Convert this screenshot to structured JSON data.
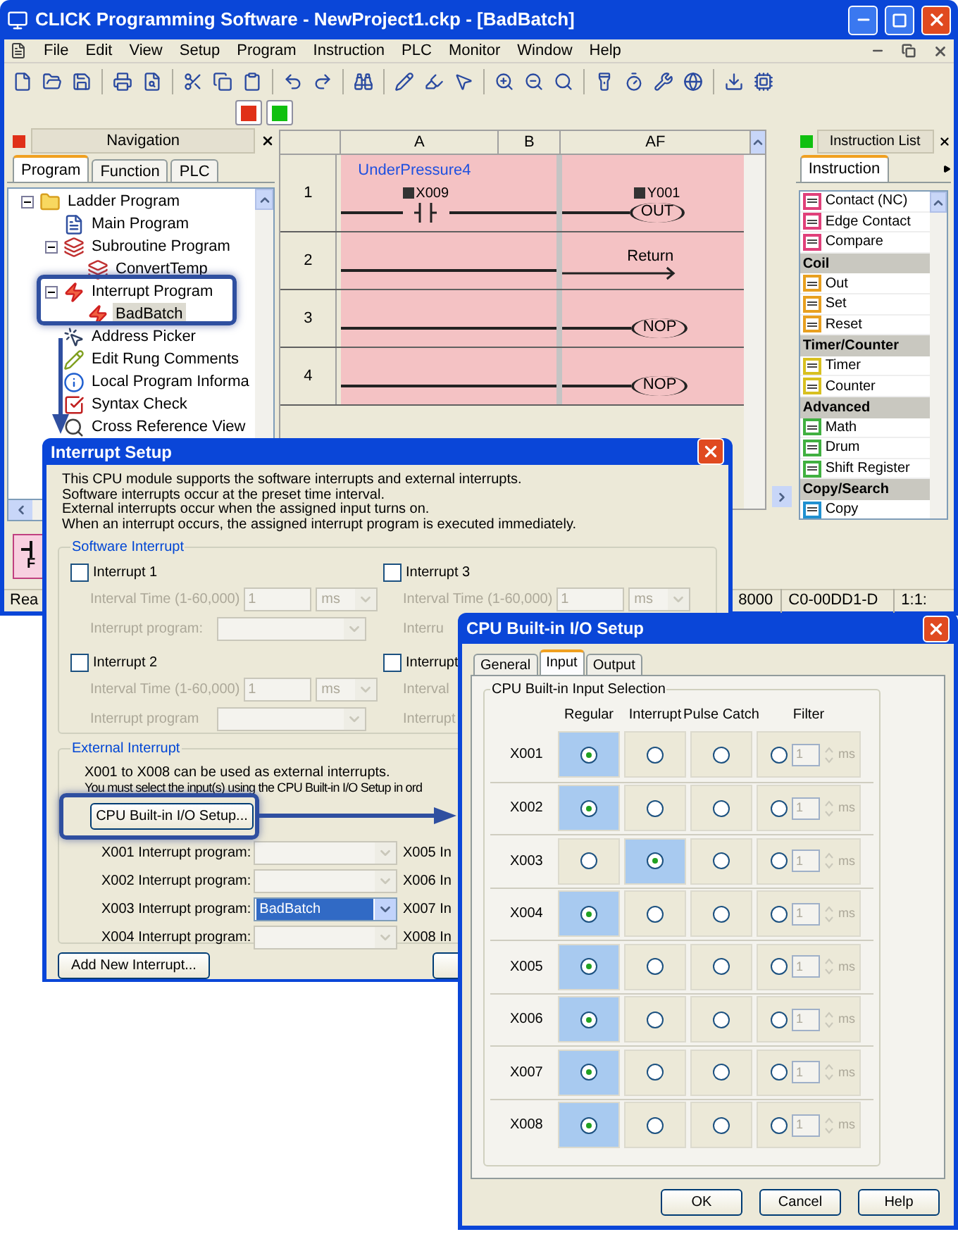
{
  "window": {
    "title": "CLICK Programming Software - NewProject1.ckp - [BadBatch]"
  },
  "menu": [
    "File",
    "Edit",
    "View",
    "Setup",
    "Program",
    "Instruction",
    "PLC",
    "Monitor",
    "Window",
    "Help"
  ],
  "navigation": {
    "title": "Navigation",
    "tabs": [
      {
        "label": "Program",
        "selected": true
      },
      {
        "label": "Function",
        "selected": false
      },
      {
        "label": "PLC",
        "selected": false
      }
    ],
    "tree": [
      {
        "label": "Ladder Program",
        "kind": "folder",
        "expanded": true,
        "selected": false,
        "children": [
          {
            "label": "Main Program",
            "kind": "program",
            "selected": false
          },
          {
            "label": "Subroutine Program",
            "kind": "subroutine",
            "expanded": true,
            "selected": false,
            "children": [
              {
                "label": "ConvertTemp",
                "kind": "subroutine",
                "selected": false
              }
            ]
          },
          {
            "label": "Interrupt Program",
            "kind": "interrupt",
            "expanded": true,
            "selected": false,
            "children": [
              {
                "label": "BadBatch",
                "kind": "interrupt",
                "selected": true
              }
            ]
          },
          {
            "label": "Address Picker",
            "kind": "picker",
            "selected": false
          },
          {
            "label": "Edit Rung Comments",
            "kind": "comment",
            "selected": false
          },
          {
            "label": "Local Program Informa",
            "kind": "info",
            "selected": false
          },
          {
            "label": "Syntax Check",
            "kind": "check",
            "selected": false
          },
          {
            "label": "Cross Reference View",
            "kind": "crossref",
            "selected": false
          }
        ]
      }
    ],
    "function_key": "F"
  },
  "ladder": {
    "columns": [
      "A",
      "B",
      "AF"
    ],
    "rows": [
      {
        "number": "1",
        "kind": "coil",
        "comment": "UnderPressure4",
        "contact": "X009",
        "coil": "Y001",
        "instruction": "OUT"
      },
      {
        "number": "2",
        "kind": "return",
        "instruction": "Return"
      },
      {
        "number": "3",
        "kind": "nop",
        "instruction": "NOP"
      },
      {
        "number": "4",
        "kind": "nop",
        "instruction": "NOP"
      }
    ]
  },
  "instruction_list": {
    "title": "Instruction List",
    "tab": "Instruction",
    "items": [
      {
        "kind": "item",
        "label": "Contact (NC)",
        "color": "#e0407a"
      },
      {
        "kind": "item",
        "label": "Edge Contact",
        "color": "#e0407a"
      },
      {
        "kind": "item",
        "label": "Compare",
        "color": "#e0407a"
      },
      {
        "kind": "category",
        "label": "Coil"
      },
      {
        "kind": "item",
        "label": "Out",
        "color": "#e8a020"
      },
      {
        "kind": "item",
        "label": "Set",
        "color": "#e8a020"
      },
      {
        "kind": "item",
        "label": "Reset",
        "color": "#e8a020"
      },
      {
        "kind": "category",
        "label": "Timer/Counter"
      },
      {
        "kind": "item",
        "label": "Timer",
        "color": "#d8c020"
      },
      {
        "kind": "item",
        "label": "Counter",
        "color": "#d8c020"
      },
      {
        "kind": "category",
        "label": "Advanced"
      },
      {
        "kind": "item",
        "label": "Math",
        "color": "#40b040"
      },
      {
        "kind": "item",
        "label": "Drum",
        "color": "#40b040"
      },
      {
        "kind": "item",
        "label": "Shift Register",
        "color": "#40b040"
      },
      {
        "kind": "category",
        "label": "Copy/Search"
      },
      {
        "kind": "item",
        "label": "Copy",
        "color": "#2090d0"
      }
    ]
  },
  "status_bar": {
    "left": "Rea",
    "fields": [
      "8000",
      "C0-00DD1-D",
      "1:1:"
    ]
  },
  "interrupt_setup": {
    "title": "Interrupt Setup",
    "description": [
      "This CPU module supports the software interrupts and external interrupts.",
      "Software interrupts occur at the preset time interval.",
      "External interrupts occur when the assigned input turns on.",
      "When an interrupt occurs, the assigned interrupt program is executed immediately."
    ],
    "software": {
      "title": "Software Interrupt",
      "interrupts": [
        {
          "kind": "full",
          "label": "Interrupt 1",
          "checked": false,
          "interval_label": "Interval Time (1-60,000)",
          "interval": "1",
          "unit": "ms",
          "program_label": "Interrupt program:"
        },
        {
          "kind": "cut",
          "label": "Interrupt 3",
          "checked": false,
          "interval_label": "Interval Time (1-60,000)",
          "interval": "1",
          "unit": "ms",
          "program_label": "Interru"
        },
        {
          "kind": "full",
          "label": "Interrupt 2",
          "checked": false,
          "interval_label": "Interval Time (1-60,000)",
          "interval": "1",
          "unit": "ms",
          "program_label": "Interrupt program"
        },
        {
          "kind": "labels",
          "label": "Interrupt",
          "checked": false,
          "interval_label": "Interval",
          "program_label": "Interrupt"
        }
      ]
    },
    "external": {
      "title": "External Interrupt",
      "notes": [
        "X001 to X008 can be used as external interrupts.",
        "You must select the input(s) using the CPU Built-in I/O Setup in ord"
      ],
      "setup_button": "CPU Built-in I/O Setup...",
      "inputs": [
        {
          "label": "X001 Interrupt program:",
          "selected": false
        },
        {
          "label": "X002 Interrupt program:",
          "selected": false
        },
        {
          "label": "X003 Interrupt program:",
          "value": "BadBatch",
          "selected": true
        },
        {
          "label": "X004 Interrupt program:",
          "selected": false
        }
      ],
      "right_labels": [
        "X005 In",
        "X006 In",
        "X007 In",
        "X008 In"
      ]
    },
    "buttons": [
      "Add New Interrupt..."
    ]
  },
  "cpu_io_setup": {
    "title": "CPU Built-in I/O Setup",
    "tabs": [
      {
        "label": "General",
        "selected": false
      },
      {
        "label": "Input",
        "selected": true
      },
      {
        "label": "Output",
        "selected": false
      }
    ],
    "group": "CPU Built-in Input Selection",
    "columns": [
      "Regular",
      "Interrupt",
      "Pulse Catch",
      "Filter"
    ],
    "filter_disabled": true,
    "rows": [
      {
        "input": "X001",
        "choices": [
          {
            "selected": true
          },
          {
            "selected": false
          },
          {
            "selected": false
          },
          {
            "selected": false
          }
        ],
        "filter": "1",
        "unit": "ms"
      },
      {
        "input": "X002",
        "choices": [
          {
            "selected": true
          },
          {
            "selected": false
          },
          {
            "selected": false
          },
          {
            "selected": false
          }
        ],
        "filter": "1",
        "unit": "ms"
      },
      {
        "input": "X003",
        "choices": [
          {
            "selected": false
          },
          {
            "selected": true
          },
          {
            "selected": false
          },
          {
            "selected": false
          }
        ],
        "filter": "1",
        "unit": "ms"
      },
      {
        "input": "X004",
        "choices": [
          {
            "selected": true
          },
          {
            "selected": false
          },
          {
            "selected": false
          },
          {
            "selected": false
          }
        ],
        "filter": "1",
        "unit": "ms"
      },
      {
        "input": "X005",
        "choices": [
          {
            "selected": true
          },
          {
            "selected": false
          },
          {
            "selected": false
          },
          {
            "selected": false
          }
        ],
        "filter": "1",
        "unit": "ms"
      },
      {
        "input": "X006",
        "choices": [
          {
            "selected": true
          },
          {
            "selected": false
          },
          {
            "selected": false
          },
          {
            "selected": false
          }
        ],
        "filter": "1",
        "unit": "ms"
      },
      {
        "input": "X007",
        "choices": [
          {
            "selected": true
          },
          {
            "selected": false
          },
          {
            "selected": false
          },
          {
            "selected": false
          }
        ],
        "filter": "1",
        "unit": "ms"
      },
      {
        "input": "X008",
        "choices": [
          {
            "selected": true
          },
          {
            "selected": false
          },
          {
            "selected": false
          },
          {
            "selected": false
          }
        ],
        "filter": "1",
        "unit": "ms"
      }
    ],
    "buttons": [
      "OK",
      "Cancel",
      "Help"
    ]
  }
}
